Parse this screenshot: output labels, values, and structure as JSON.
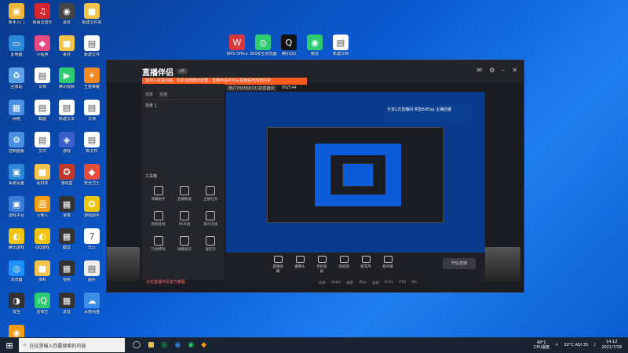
{
  "desktop_icons": [
    {
      "label": "新手入门",
      "color": "#f3b63a",
      "glyph": "▣"
    },
    {
      "label": "网易云音乐",
      "color": "#d8242f",
      "glyph": "♫"
    },
    {
      "label": "录屏",
      "color": "#444444",
      "glyph": "◉"
    },
    {
      "label": "新建文件夹",
      "color": "#f3c34a",
      "glyph": "■"
    },
    {
      "label": "此电脑",
      "color": "#2b88d8",
      "glyph": "▭"
    },
    {
      "label": "小程序",
      "color": "#e84a82",
      "glyph": "◆"
    },
    {
      "label": "素材",
      "color": "#f3c34a",
      "glyph": "■"
    },
    {
      "label": "新建文件",
      "color": "#ffffff",
      "glyph": "▤"
    },
    {
      "label": "回收站",
      "color": "#5aa0e6",
      "glyph": "♻"
    },
    {
      "label": "文档",
      "color": "#ffffff",
      "glyph": "▤"
    },
    {
      "label": "腾讯视频",
      "color": "#2ecc71",
      "glyph": "▶"
    },
    {
      "label": "王者荣耀",
      "color": "#f08a24",
      "glyph": "✦"
    },
    {
      "label": "网络",
      "color": "#4a90e2",
      "glyph": "▦"
    },
    {
      "label": "截图",
      "color": "#ffffff",
      "glyph": "▤"
    },
    {
      "label": "新建文本",
      "color": "#ffffff",
      "glyph": "▤"
    },
    {
      "label": "文档",
      "color": "#ffffff",
      "glyph": "▤"
    },
    {
      "label": "控制面板",
      "color": "#4a90e2",
      "glyph": "⚙"
    },
    {
      "label": "文件",
      "color": "#ffffff",
      "glyph": "▤"
    },
    {
      "label": "游戏",
      "color": "#3a5fcd",
      "glyph": "◈"
    },
    {
      "label": "新文件",
      "color": "#ffffff",
      "glyph": "▤"
    },
    {
      "label": "系统设置",
      "color": "#2b88d8",
      "glyph": "▣"
    },
    {
      "label": "素材夹",
      "color": "#f3c34a",
      "glyph": "■"
    },
    {
      "label": "游戏盒",
      "color": "#c0392b",
      "glyph": "✪"
    },
    {
      "label": "安全卫士",
      "color": "#e74c3c",
      "glyph": "◆"
    },
    {
      "label": "游戏平台",
      "color": "#3a7bd5",
      "glyph": "▣"
    },
    {
      "label": "火柴人",
      "color": "#f39c12",
      "glyph": "画"
    },
    {
      "label": "录像",
      "color": "#333333",
      "glyph": "▦"
    },
    {
      "label": "游戏助手",
      "color": "#f1c40f",
      "glyph": "✪"
    },
    {
      "label": "腾讯游戏",
      "color": "#f1c40f",
      "glyph": "◐"
    },
    {
      "label": "QQ游戏",
      "color": "#f1c40f",
      "glyph": "◐"
    },
    {
      "label": "截屏",
      "color": "#333333",
      "glyph": "▦"
    },
    {
      "label": "日历",
      "color": "#ffffff",
      "glyph": "7"
    },
    {
      "label": "浏览器",
      "color": "#1e90ff",
      "glyph": "◎"
    },
    {
      "label": "资料",
      "color": "#f3c34a",
      "glyph": "■"
    },
    {
      "label": "视频",
      "color": "#333333",
      "glyph": "▦"
    },
    {
      "label": "图片",
      "color": "#eeeeee",
      "glyph": "▤"
    },
    {
      "label": "安全",
      "color": "#333333",
      "glyph": "◑"
    },
    {
      "label": "爱奇艺",
      "color": "#2ecc71",
      "glyph": "iQ"
    },
    {
      "label": "录音",
      "color": "#333333",
      "glyph": "▦"
    },
    {
      "label": "百度网盘",
      "color": "#3a8ee6",
      "glyph": "☁"
    },
    {
      "label": "播放器",
      "color": "#f39c12",
      "glyph": "◉"
    }
  ],
  "top_icons": [
    {
      "label": "WPS Office",
      "color": "#d9363e",
      "glyph": "W"
    },
    {
      "label": "360安全浏览器",
      "color": "#2ecc71",
      "glyph": "◎"
    },
    {
      "label": "腾讯QQ",
      "color": "#111111",
      "glyph": "Q"
    },
    {
      "label": "微信",
      "color": "#2ecc71",
      "glyph": "◉"
    },
    {
      "label": "新建文档",
      "color": "#ffffff",
      "glyph": "▤"
    }
  ],
  "app": {
    "logo": "直播伴侣",
    "version": "v5",
    "notice": "如何入驻音内容，如有违规做出处理，直播伴侣不可以直播任何违规内容",
    "tabs": [
      "场景",
      "直播"
    ],
    "scene_label": "场景 1",
    "user_label": "用户706566131的直播间",
    "user_id": "992544",
    "tools_title": "工具箱",
    "tools": [
      "弹幕助手",
      "直播数据",
      "主播任务",
      "视频连线",
      "PK对战",
      "观众连线",
      "礼物特效",
      "弹幕展示",
      "发红包"
    ],
    "warn_text": "点击直播伴侣官方教程",
    "ad_text": "分享1次直播间 奖励50Exp 主播应援",
    "controls": [
      "直播屏幕",
      "摄像头",
      "手机投屏",
      "添加源",
      "麦克风",
      "扬声器"
    ],
    "live_button": "开始直播",
    "stats": [
      "码率",
      "0kb/s",
      "帧率",
      "0fps",
      "丢帧",
      "0.0%",
      "CPU",
      "0%"
    ]
  },
  "taskbar": {
    "search_placeholder": "在这里输入你要搜索的内容",
    "cpu_temp": "48°C",
    "cpu_label": "CPU温度",
    "weather": "32°C AQI 35",
    "time": "14:12",
    "date": "2021/7/18"
  }
}
